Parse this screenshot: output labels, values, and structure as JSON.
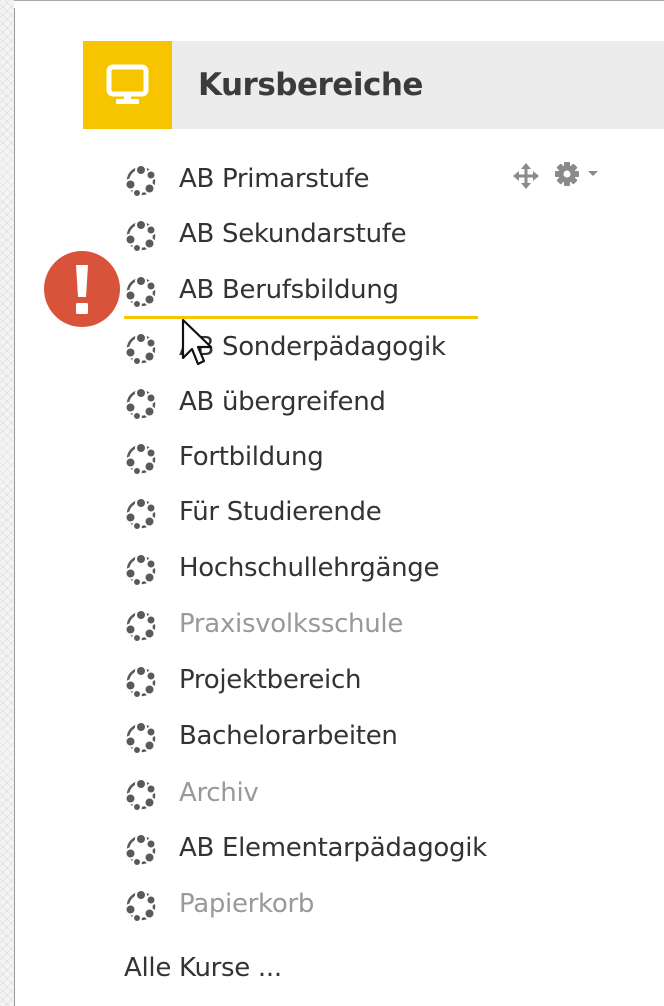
{
  "block": {
    "title": "Kursbereiche",
    "icon": "monitor-icon",
    "accent_color": "#f7c500"
  },
  "categories": [
    {
      "label": "AB Primarstufe",
      "visible": true
    },
    {
      "label": "AB Sekundarstufe",
      "visible": true
    },
    {
      "label": "AB Berufsbildung",
      "visible": true
    },
    {
      "label": "AB Sonderpädagogik",
      "visible": true
    },
    {
      "label": "AB übergreifend",
      "visible": true
    },
    {
      "label": "Fortbildung",
      "visible": true
    },
    {
      "label": "Für Studierende",
      "visible": true
    },
    {
      "label": "Hochschullehrgänge",
      "visible": true
    },
    {
      "label": "Praxisvolksschule",
      "visible": false
    },
    {
      "label": "Projektbereich",
      "visible": true
    },
    {
      "label": "Bachelorarbeiten",
      "visible": true
    },
    {
      "label": "Archiv",
      "visible": false
    },
    {
      "label": "AB Elementarpädagogik",
      "visible": true
    },
    {
      "label": "Papierkorb",
      "visible": false
    }
  ],
  "all_courses_link": "Alle Kurse ...",
  "controls": {
    "move_icon": "move-arrows-icon",
    "settings_icon": "gear-icon",
    "dropdown_icon": "caret-down-icon"
  },
  "alert": {
    "icon": "exclamation-icon",
    "color": "#d9533b"
  },
  "drag_indicator_color": "#f7c500",
  "cursor_icon": "mouse-pointer-icon"
}
